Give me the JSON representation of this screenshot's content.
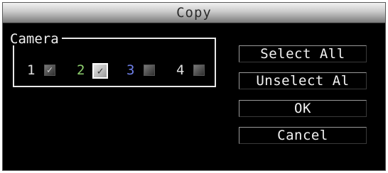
{
  "dialog": {
    "title": "Copy"
  },
  "camera_group": {
    "legend": "Camera",
    "cameras": [
      {
        "number": "1",
        "checked": true,
        "number_color": "#e0e0e0"
      },
      {
        "number": "2",
        "checked": true,
        "focused": true,
        "number_color": "#8fd06f"
      },
      {
        "number": "3",
        "checked": false,
        "number_color": "#6e7fe8"
      },
      {
        "number": "4",
        "checked": false,
        "number_color": "#e0e0e0"
      }
    ]
  },
  "buttons": {
    "select_all": "Select All",
    "unselect_all": "Unselect Al",
    "ok": "OK",
    "cancel": "Cancel"
  },
  "icons": {
    "checkmark": "checkmark-icon"
  }
}
